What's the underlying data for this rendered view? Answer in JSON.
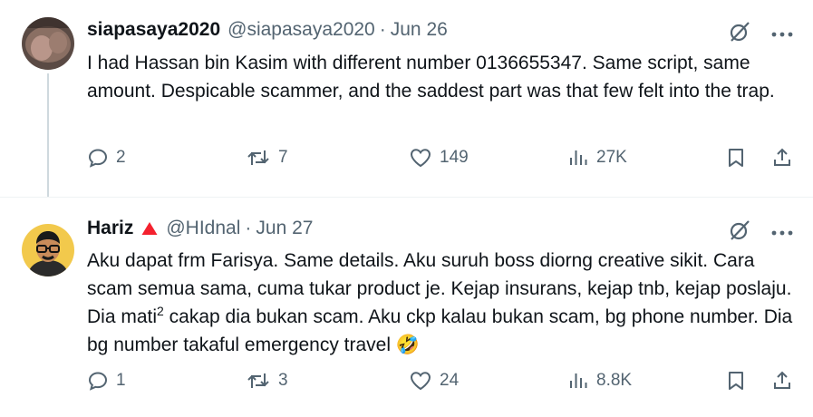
{
  "tweets": [
    {
      "name": "siapasaya2020",
      "handle": "@siapasaya2020",
      "separator": "·",
      "date": "Jun 26",
      "text": "I had Hassan bin Kasim with different number 0136655347. Same script, same amount. Despicable scammer, and the saddest part was that few felt into the trap.",
      "replies": "2",
      "retweets": "7",
      "likes": "149",
      "views": "27K"
    },
    {
      "name": "Hariz",
      "handle": "@HIdnal",
      "separator": "·",
      "date": "Jun 27",
      "text_parts": {
        "before_sup": "Aku dapat frm Farisya. Same details. Aku suruh boss diorng creative sikit. Cara scam semua sama, cuma tukar product je. Kejap insurans, kejap tnb, kejap poslaju. Dia mati",
        "sup": "2",
        "after_sup": " cakap dia bukan scam. Aku ckp kalau bukan scam, bg phone number. Dia bg number takaful emergency travel ",
        "emoji": "🤣"
      },
      "replies": "1",
      "retweets": "3",
      "likes": "24",
      "views": "8.8K"
    }
  ],
  "icons": {
    "grok": "grok-icon",
    "more": "more-icon",
    "reply": "reply-icon",
    "retweet": "retweet-icon",
    "like": "heart-icon",
    "views": "views-icon",
    "bookmark": "bookmark-icon",
    "share": "share-icon",
    "badge": "red-triangle-icon"
  },
  "colors": {
    "text": "#0f1419",
    "secondary": "#536471",
    "thread_line": "#cfd9de",
    "badge": "#f4212e"
  }
}
